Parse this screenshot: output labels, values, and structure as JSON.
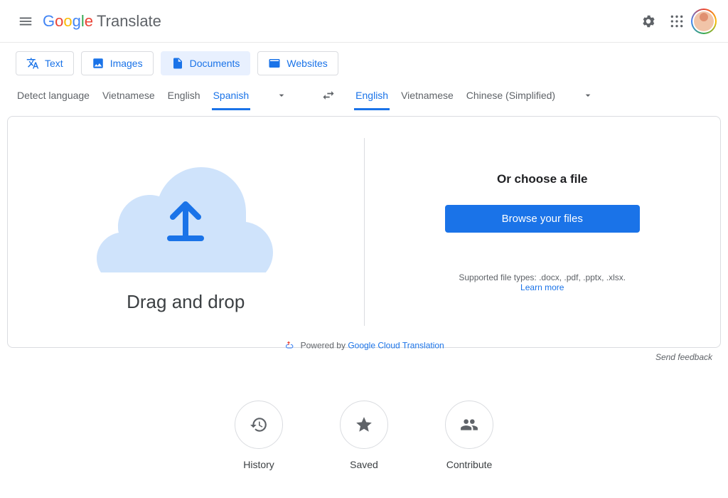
{
  "header": {
    "app_name": "Translate"
  },
  "modes": [
    {
      "label": "Text"
    },
    {
      "label": "Images"
    },
    {
      "label": "Documents"
    },
    {
      "label": "Websites"
    }
  ],
  "source_langs": [
    "Detect language",
    "Vietnamese",
    "English",
    "Spanish"
  ],
  "target_langs": [
    "English",
    "Vietnamese",
    "Chinese (Simplified)"
  ],
  "upload": {
    "drag_label": "Drag and drop",
    "choose_label": "Or choose a file",
    "browse_label": "Browse your files",
    "supported_prefix": "Supported file types: .docx, .pdf, .pptx, .xlsx.",
    "learn_more": "Learn more"
  },
  "powered": {
    "prefix": "Powered by ",
    "link": "Google Cloud Translation"
  },
  "feedback": "Send feedback",
  "bottom": [
    {
      "label": "History"
    },
    {
      "label": "Saved"
    },
    {
      "label": "Contribute"
    }
  ]
}
